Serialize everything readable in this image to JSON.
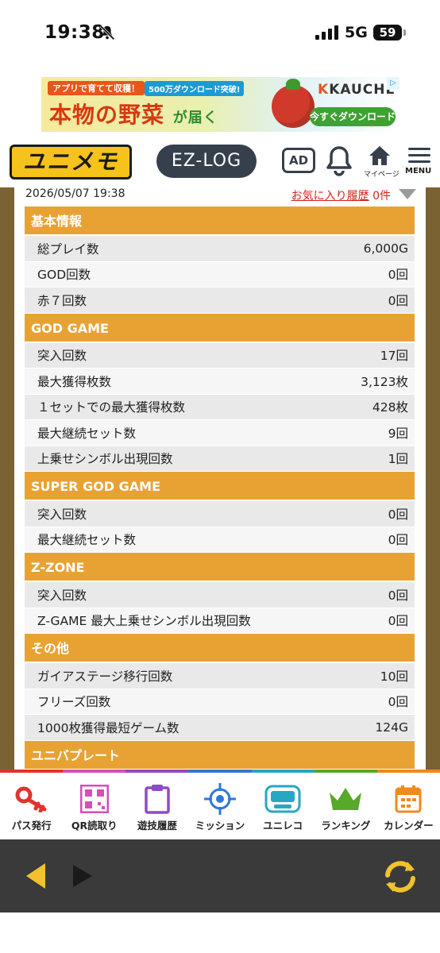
{
  "status": {
    "time": "19:38",
    "network": "5G",
    "battery": "59"
  },
  "ad": {
    "tag": "アプリで育てて収穫！",
    "tag2": "500万ダウンロード突破!",
    "headline": "本物の野菜",
    "headline_suffix": "が届く",
    "brand": "KAUCHE",
    "cta": "今すぐダウンロード"
  },
  "header": {
    "logo": "ユニメモ",
    "ezlog": "EZ-LOG",
    "ad_button": "AD",
    "mypage": "マイページ",
    "menu": "MENU"
  },
  "meta": {
    "date": "2026/05/07 19:38",
    "favorites": "お気に入り履歴",
    "count": "0件"
  },
  "sections": [
    {
      "title": "基本情報",
      "rows": [
        {
          "label": "総プレイ数",
          "value": "6,000G"
        },
        {
          "label": "GOD回数",
          "value": "0回"
        },
        {
          "label": "赤７回数",
          "value": "0回"
        }
      ]
    },
    {
      "title": "GOD GAME",
      "rows": [
        {
          "label": "突入回数",
          "value": "17回"
        },
        {
          "label": "最大獲得枚数",
          "value": "3,123枚"
        },
        {
          "label": "１セットでの最大獲得枚数",
          "value": "428枚"
        },
        {
          "label": "最大継続セット数",
          "value": "9回"
        },
        {
          "label": "上乗せシンボル出現回数",
          "value": "1回"
        }
      ]
    },
    {
      "title": "SUPER GOD GAME",
      "rows": [
        {
          "label": "突入回数",
          "value": "0回"
        },
        {
          "label": "最大継続セット数",
          "value": "0回"
        }
      ]
    },
    {
      "title": "Z-ZONE",
      "rows": [
        {
          "label": "突入回数",
          "value": "0回"
        },
        {
          "label": "Z-GAME 最大上乗せシンボル出現回数",
          "value": "0回"
        }
      ]
    },
    {
      "title": "その他",
      "rows": [
        {
          "label": "ガイアステージ移行回数",
          "value": "10回"
        },
        {
          "label": "フリーズ回数",
          "value": "0回"
        },
        {
          "label": "1000枚獲得最短ゲーム数",
          "value": "124G"
        }
      ]
    },
    {
      "title": "ユニバプレート",
      "rows": []
    }
  ],
  "tabs": [
    {
      "label": "パス発行",
      "icon": "key-icon",
      "color": "#e0342b"
    },
    {
      "label": "QR読取り",
      "icon": "qr-icon",
      "color": "#d54fb6"
    },
    {
      "label": "遊技履歴",
      "icon": "clipboard-icon",
      "color": "#8e4bc7"
    },
    {
      "label": "ミッション",
      "icon": "target-icon",
      "color": "#2f78d8"
    },
    {
      "label": "ユニレコ",
      "icon": "unireco-icon",
      "color": "#27a7c2"
    },
    {
      "label": "ランキング",
      "icon": "crown-icon",
      "color": "#58a82a"
    },
    {
      "label": "カレンダー",
      "icon": "calendar-icon",
      "color": "#f08a1c"
    }
  ]
}
